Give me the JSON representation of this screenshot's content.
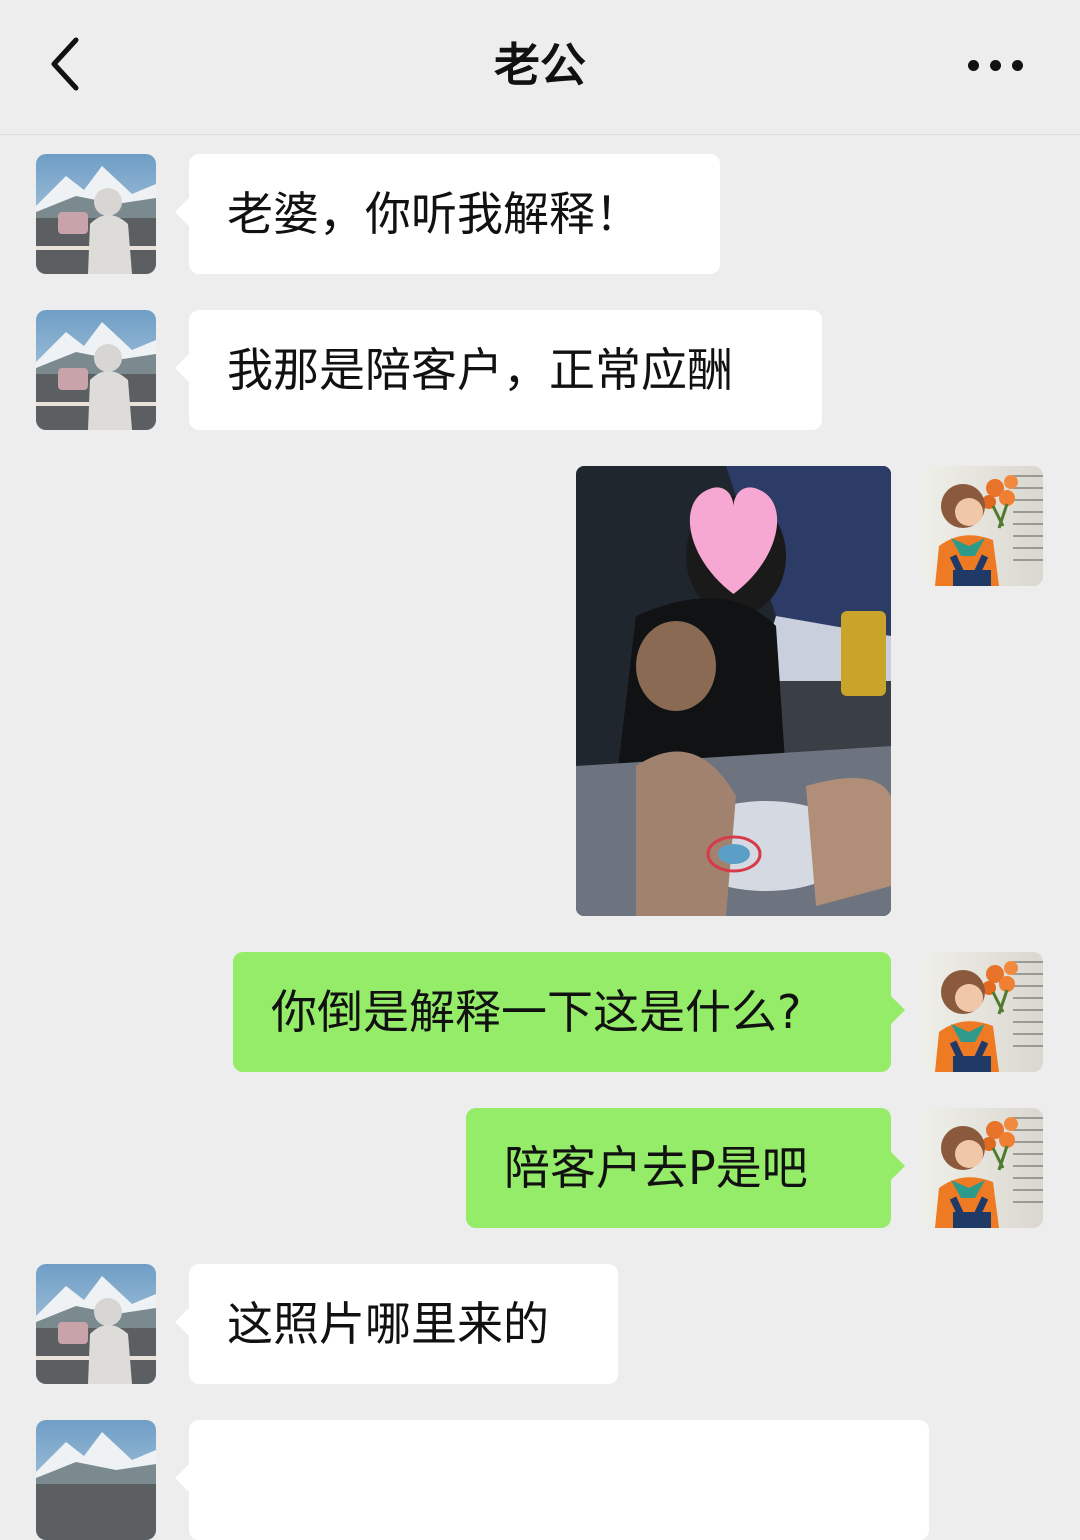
{
  "header": {
    "title": "老公",
    "back_icon": "chevron-left-icon",
    "more_icon": "more-dots-icon"
  },
  "messages": [
    {
      "side": "left",
      "type": "text",
      "text": "老婆，你听我解释！"
    },
    {
      "side": "left",
      "type": "text",
      "text": "我那是陪客户，正常应酬"
    },
    {
      "side": "right",
      "type": "image",
      "description_icon": "photo-thumbnail"
    },
    {
      "side": "right",
      "type": "text",
      "text": "你倒是解释一下这是什么?"
    },
    {
      "side": "right",
      "type": "text",
      "text": "陪客户去P是吧"
    },
    {
      "side": "left",
      "type": "text",
      "text": "这照片哪里来的"
    },
    {
      "side": "left",
      "type": "text",
      "text": ""
    }
  ],
  "colors": {
    "background": "#ededed",
    "incoming_bubble": "#ffffff",
    "outgoing_bubble": "#95ec69"
  }
}
